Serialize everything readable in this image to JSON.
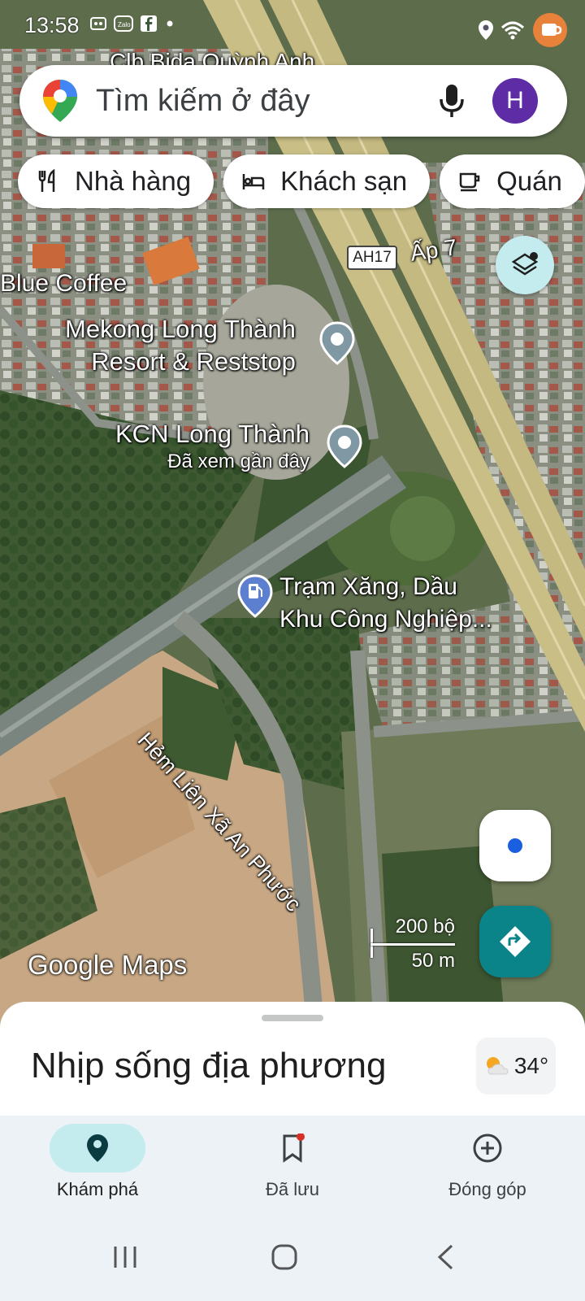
{
  "status_bar": {
    "time": "13:58",
    "left_icons": [
      "contact-icon",
      "zalo-icon",
      "facebook-icon",
      "dot-icon"
    ],
    "right_icons": [
      "location-icon",
      "wifi-icon",
      "notification-icon"
    ]
  },
  "search": {
    "placeholder": "Tìm kiếm ở đây",
    "avatar_letter": "H"
  },
  "chips": [
    {
      "label": "Nhà hàng",
      "icon": "restaurant-icon"
    },
    {
      "label": "Khách sạn",
      "icon": "hotel-icon"
    },
    {
      "label": "Quán",
      "icon": "cafe-icon"
    }
  ],
  "map_labels": {
    "top_partial": "Clb Bida Quỳnh Anh",
    "road_shield": "AH17",
    "ap7": "Ấp 7",
    "blue_coffee": "Blue Coffee",
    "mekong_line1": "Mekong Long Thành",
    "mekong_line2": "Resort & Reststop",
    "kcn_title": "KCN Long Thành",
    "kcn_sub": "Đã xem gần đây",
    "tram_line1": "Trạm Xăng, Dầu",
    "tram_line2": "Khu Công Nghiệp...",
    "street": "Hẻm Liên Xã An Phước",
    "scale_top": "200 bộ",
    "scale_bottom": "50 m",
    "attribution": "Google Maps"
  },
  "sheet": {
    "title": "Nhịp sống địa phương",
    "temperature": "34°"
  },
  "nav": [
    {
      "label": "Khám phá",
      "icon": "explore-pin-icon",
      "active": true
    },
    {
      "label": "Đã lưu",
      "icon": "bookmark-icon",
      "active": false
    },
    {
      "label": "Đóng góp",
      "icon": "add-circle-icon",
      "active": false
    }
  ],
  "colors": {
    "accent_teal": "#0b8489",
    "active_pill": "#c4ecef",
    "avatar": "#5e2ca5"
  }
}
